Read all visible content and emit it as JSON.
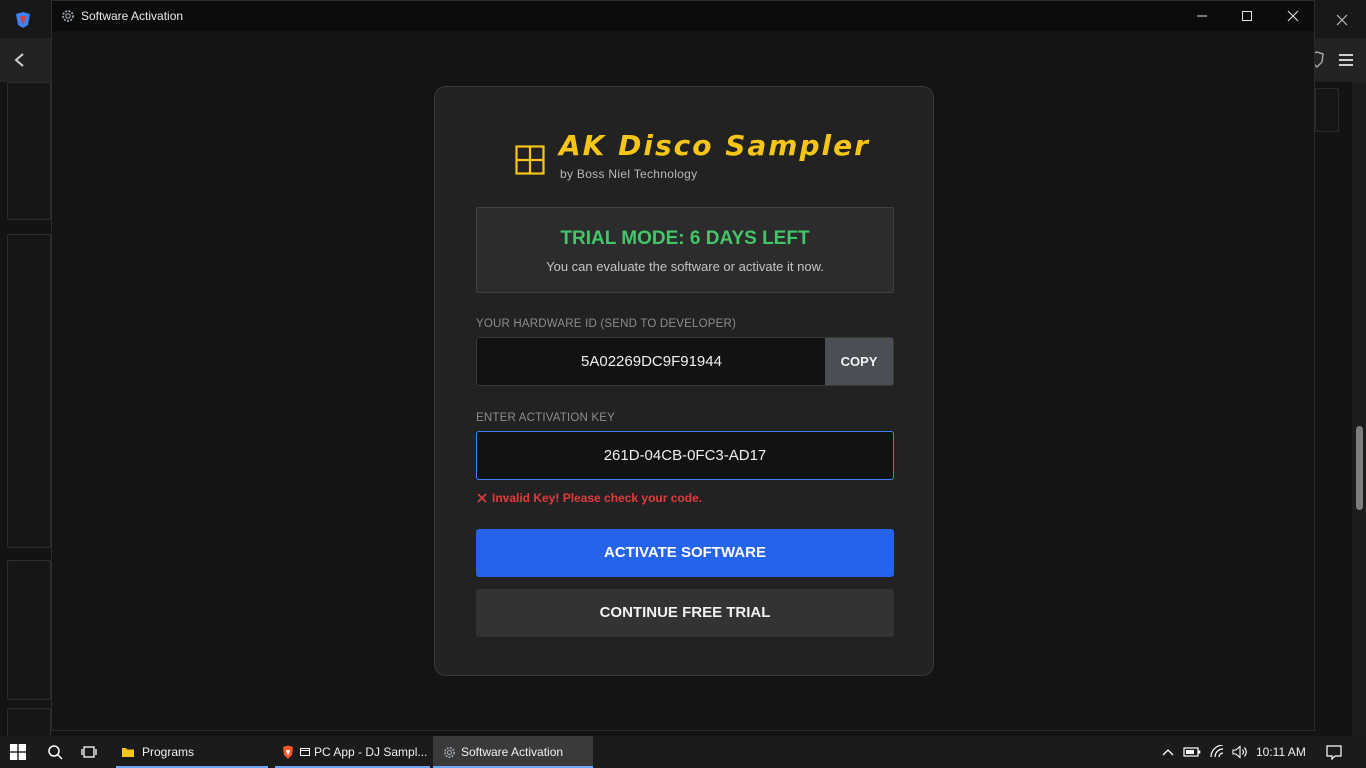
{
  "window": {
    "title": "Software Activation"
  },
  "brand": {
    "name": "AK Disco Sampler",
    "subtitle": "by Boss Niel Technology"
  },
  "trial": {
    "title": "TRIAL MODE: 6 DAYS LEFT",
    "message": "You can evaluate the software or activate it now."
  },
  "hardware": {
    "label": "YOUR HARDWARE ID (SEND TO DEVELOPER)",
    "value": "5A02269DC9F91944",
    "copy_label": "COPY"
  },
  "activation": {
    "label": "ENTER ACTIVATION KEY",
    "key_value": "261D-04CB-0FC3-AD17",
    "error": "Invalid Key! Please check your code.",
    "activate_label": "ACTIVATE SOFTWARE",
    "trial_label": "CONTINUE FREE TRIAL"
  },
  "taskbar": {
    "apps": [
      {
        "label": "Programs"
      },
      {
        "label": "PC App - DJ Sampl..."
      },
      {
        "label": "Software Activation"
      }
    ],
    "time": "10:11 AM"
  },
  "colors": {
    "accent": "#2563eb",
    "brand": "#f5c518",
    "trial": "#43c66a",
    "error": "#e23b3b"
  }
}
